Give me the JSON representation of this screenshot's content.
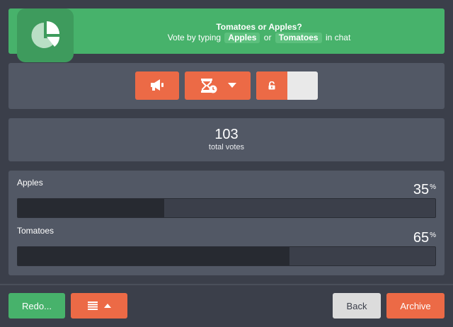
{
  "banner": {
    "title": "Tomatoes or Apples?",
    "instruction_prefix": "Vote by typing",
    "keyword_1": "Apples",
    "connector": "or",
    "keyword_2": "Tomatoes",
    "instruction_suffix": "in chat",
    "icon": "pie-chart-icon"
  },
  "controls": {
    "announce_icon": "megaphone-icon",
    "timer_icon": "hourglass-clock-icon",
    "timer_dropdown_icon": "caret-down-icon",
    "lock_icon": "unlock-icon",
    "lock_toggle_state": "unlocked"
  },
  "totals": {
    "count": "103",
    "label": "total votes"
  },
  "results": [
    {
      "label": "Apples",
      "percent": "35",
      "percent_symbol": "%",
      "share": 0.35
    },
    {
      "label": "Tomatoes",
      "percent": "65",
      "percent_symbol": "%",
      "share": 0.65
    }
  ],
  "footer": {
    "redo_label": "Redo...",
    "list_icon": "list-icon",
    "list_caret_icon": "caret-up-icon",
    "back_label": "Back",
    "archive_label": "Archive"
  },
  "colors": {
    "green": "#47b26b",
    "orange": "#ec6a46",
    "panel": "#525865",
    "background": "#3b3f4a"
  }
}
